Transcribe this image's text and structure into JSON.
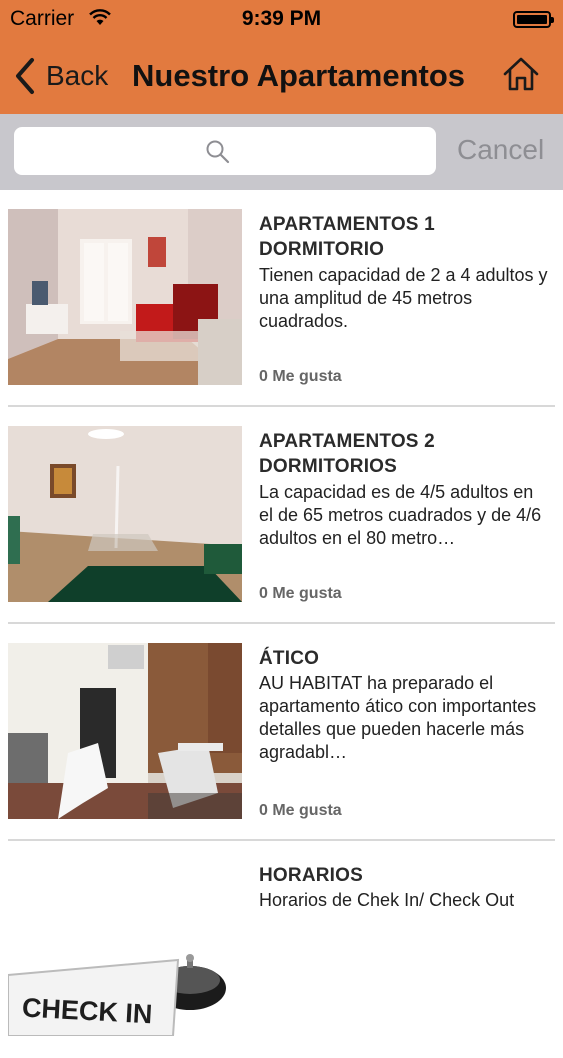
{
  "status_bar": {
    "carrier": "Carrier",
    "time": "9:39 PM"
  },
  "nav": {
    "back_label": "Back",
    "title": "Nuestro Apartamentos",
    "home_icon": "home-icon"
  },
  "search": {
    "placeholder": "",
    "cancel_label": "Cancel"
  },
  "items": [
    {
      "title": "APARTAMENTOS 1 DORMITORIO",
      "description": "Tienen capacidad de 2 a 4 adultos y una amplitud de 45 metros cuadrados.",
      "likes": "0 Me gusta"
    },
    {
      "title": "APARTAMENTOS 2 DORMITORIOS",
      "description": "La capacidad es de 4/5 adultos en el de 65 metros cuadrados y de 4/6 adultos en el 80 metro…",
      "likes": "0 Me gusta"
    },
    {
      "title": "ÁTICO",
      "description": "AU HABITAT ha preparado el apartamento ático con importantes detalles que pueden hacerle más agradabl…",
      "likes": "0 Me gusta"
    },
    {
      "title": "HORARIOS",
      "description": "Horarios de Chek In/ Check Out",
      "image_text": "CHECK IN"
    }
  ],
  "colors": {
    "nav_background": "#e27a3f",
    "search_background": "#c8c7cc",
    "separator": "#d8d8d8"
  }
}
